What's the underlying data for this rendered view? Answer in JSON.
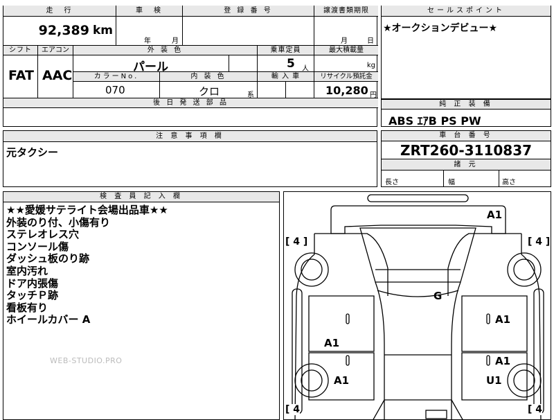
{
  "top_form": {
    "mileage_label": "走　行",
    "mileage_value": "92,389",
    "mileage_unit": "km",
    "inspection_label": "車　検",
    "inspection_year": "年",
    "inspection_month": "月",
    "registration_label": "登 録 番 号",
    "transfer_deadline_label": "譲渡書類期限",
    "transfer_month": "月",
    "transfer_day": "日",
    "shift_label": "シフト",
    "shift_value": "FAT",
    "aircon_label": "エアコン",
    "aircon_value": "AAC",
    "exterior_color_label": "外 装 色",
    "exterior_color_value": "パール",
    "capacity_label": "乗車定員",
    "capacity_value": "5",
    "capacity_unit": "人",
    "max_load_label": "最大積載量",
    "max_load_unit": "kg",
    "color_no_label": "カラーNo.",
    "color_no_value": "070",
    "interior_color_label": "内 装 色",
    "interior_color_value": "クロ",
    "interior_color_suffix": "系",
    "import_label": "輸 入 車",
    "recycle_label": "リサイクル預託金",
    "recycle_value": "10,280",
    "recycle_unit": "円",
    "later_parts_label": "後 日 発 送 部 品"
  },
  "sales_point": {
    "label": "セールスポイント",
    "text": "★オークションデビュー★"
  },
  "genuine_equipment": {
    "label": "純 正 装 備",
    "text": "ABS ｴｱB PS PW"
  },
  "caution": {
    "label": "注 意 事 項 欄",
    "text": "元タクシー"
  },
  "chassis": {
    "label": "車 台 番 号",
    "value": "ZRT260-3110837"
  },
  "dimensions": {
    "label": "諸 元",
    "length": "長さ",
    "width": "幅",
    "height": "高さ"
  },
  "inspector": {
    "label": "検 査 員 記 入 欄",
    "lines": [
      "★★愛媛サテライト会場出品車★★",
      "外装のり付、小傷有り",
      "ステレオレス穴",
      "コンソール傷",
      "ダッシュ板のり跡",
      "室内汚れ",
      "ドア内張傷",
      "タッチＰ跡",
      "看板有り",
      "ホイールカバー A"
    ]
  },
  "diagram": {
    "marks": {
      "rear": "A1",
      "roof": "G",
      "rear_right_door": "A1",
      "front_right_door": "A1",
      "rear_left_door": "A1",
      "front_left_wheel": "A1",
      "front_right_wheel": "U1"
    },
    "tread": {
      "left_upper": "[ 4 ]",
      "right_upper": "[ 4 ]",
      "left_lower": "[ 4",
      "right_lower": "[ 4"
    }
  },
  "watermark": "WEB-STUDIO.PRO"
}
